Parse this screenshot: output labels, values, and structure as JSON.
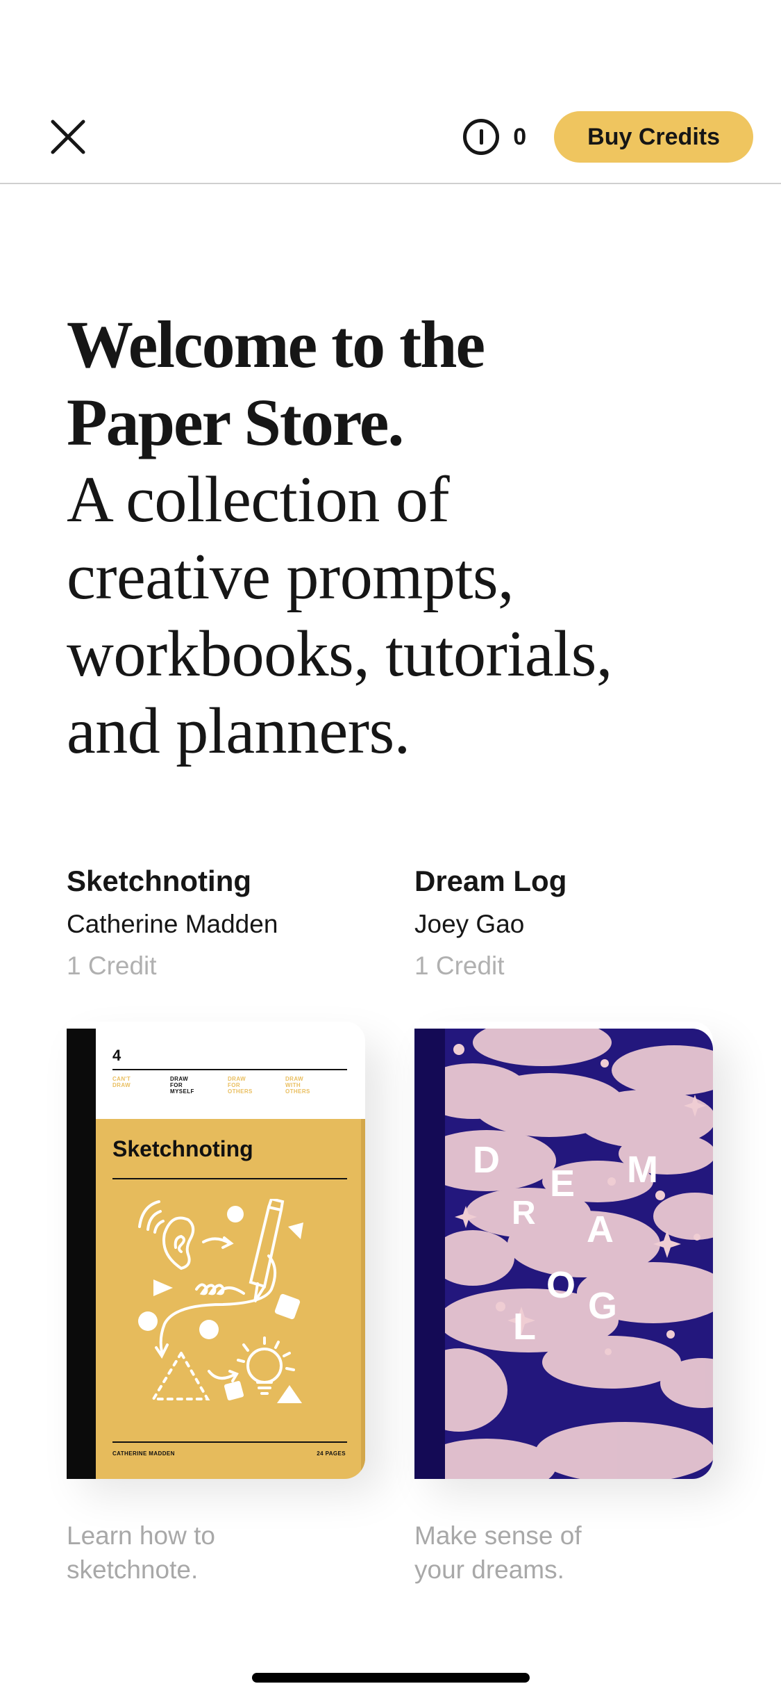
{
  "header": {
    "close_icon": "close-icon",
    "credit_icon": "coin-icon",
    "credit_balance": "0",
    "buy_credits_label": "Buy Credits",
    "accent_color": "#efc55f"
  },
  "hero": {
    "title_line1": "Welcome to the",
    "title_line2": "Paper Store.",
    "subtitle_lines": [
      "A collection of",
      "creative prompts,",
      "workbooks, tutorials,",
      "and planners."
    ]
  },
  "products": [
    {
      "title": "Sketchnoting",
      "author": "Catherine Madden",
      "price": "1 Credit",
      "description_lines": [
        "Learn how to",
        "sketchnote."
      ],
      "cover": {
        "number": "4",
        "categories": [
          "CAN'T\nDRAW",
          "DRAW\nFOR\nMYSELF",
          "DRAW\nFOR\nOTHERS",
          "DRAW\nWITH\nOTHERS"
        ],
        "active_category": "DRAW FOR MYSELF",
        "title": "Sketchnoting",
        "footer_author": "CATHERINE MADDEN",
        "footer_pages": "24 PAGES",
        "color": "#e6bb5c"
      }
    },
    {
      "title": "Dream Log",
      "author": "Joey Gao",
      "price": "1 Credit",
      "description_lines": [
        "Make sense of",
        "your dreams."
      ],
      "cover": {
        "letters": [
          "D",
          "R",
          "E",
          "A",
          "M",
          "L",
          "O",
          "G"
        ],
        "color": "#23177d",
        "cloud_color": "#efcdd3"
      }
    }
  ]
}
